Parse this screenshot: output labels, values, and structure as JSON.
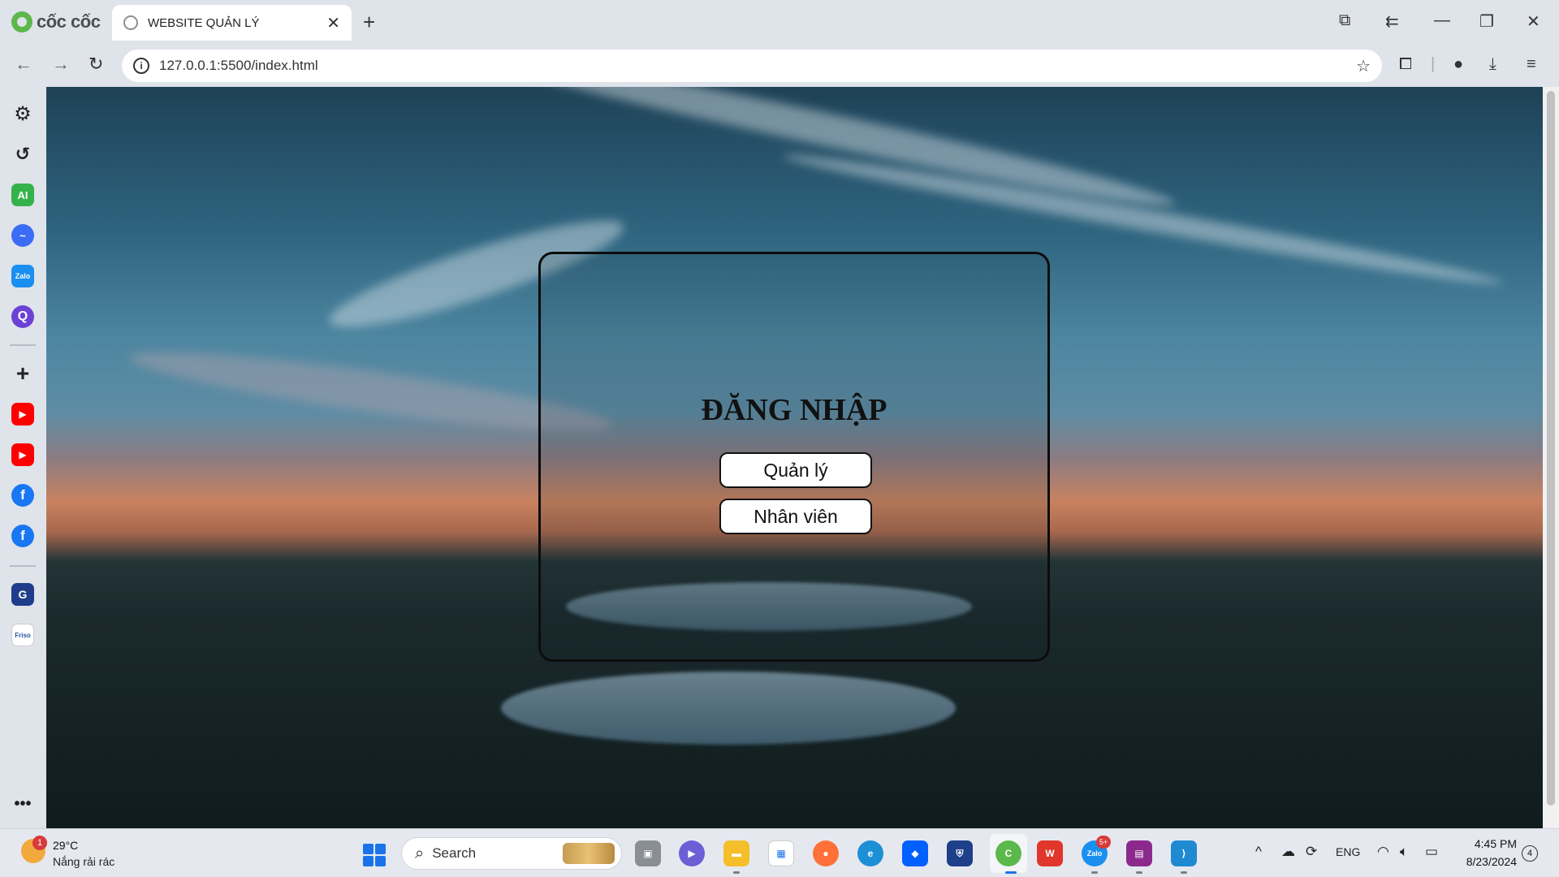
{
  "browser": {
    "logo_text": "cốc cốc",
    "tab_title": "WEBSITE QUẢN LÝ",
    "url": "127.0.0.1:5500/index.html"
  },
  "login": {
    "title": "ĐĂNG NHẬP",
    "buttons": [
      "Quản lý",
      "Nhân viên"
    ]
  },
  "sidebar": {
    "items": [
      "gear-icon",
      "history-icon",
      "ai-icon",
      "messenger-icon",
      "zalo-icon",
      "search-q-icon",
      "add-icon",
      "youtube-icon",
      "youtube-icon",
      "facebook-icon",
      "facebook-icon",
      "game-icon",
      "friso-icon",
      "more-icon"
    ],
    "ai_label": "AI",
    "zalo_label": "Zalo",
    "friso_label": "Friso"
  },
  "taskbar": {
    "weather_temp": "29°C",
    "weather_desc": "Nắng rải rác",
    "weather_badge": "1",
    "search_label": "Search",
    "zalo_badge": "5+",
    "language": "ENG",
    "time": "4:45 PM",
    "date": "8/23/2024",
    "notifications": "4"
  },
  "colors": {
    "card_border": "#0c0c0c",
    "button_bg": "#ffffff",
    "accent_green": "#5bb84b"
  }
}
